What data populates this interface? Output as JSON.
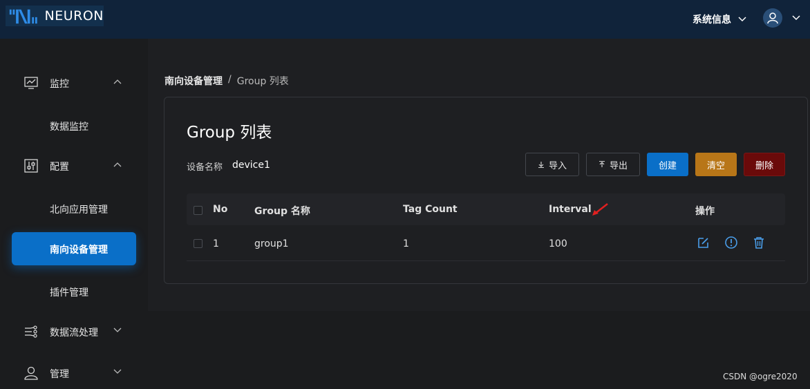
{
  "app": {
    "name": "NEURON"
  },
  "header": {
    "system_info_label": "系统信息"
  },
  "sidebar": {
    "groups": [
      {
        "label": "监控",
        "icon": "chart-monitor-icon",
        "items": [
          {
            "label": "数据监控"
          }
        ]
      },
      {
        "label": "配置",
        "icon": "config-sliders-icon",
        "items": [
          {
            "label": "北向应用管理"
          },
          {
            "label": "南向设备管理",
            "active": true
          },
          {
            "label": "插件管理"
          }
        ]
      },
      {
        "label": "数据流处理",
        "icon": "data-flow-icon",
        "items": []
      },
      {
        "label": "管理",
        "icon": "user-admin-icon",
        "items": []
      }
    ]
  },
  "breadcrumb": {
    "parent": "南向设备管理",
    "separator": "/",
    "current": "Group 列表"
  },
  "page": {
    "title": "Group 列表",
    "device_label": "设备名称",
    "device_name": "device1"
  },
  "toolbar": {
    "import_label": "导入",
    "export_label": "导出",
    "create_label": "创建",
    "clear_label": "清空",
    "delete_label": "删除"
  },
  "table": {
    "columns": [
      "No",
      "Group 名称",
      "Tag Count",
      "Interval",
      "操作"
    ],
    "rows": [
      {
        "no": "1",
        "name": "group1",
        "tag_count": "1",
        "interval": "100"
      }
    ]
  },
  "colors": {
    "primary": "#0a6fc8",
    "warning": "#b87618",
    "danger": "#6a0a0a",
    "header_bg": "#10233a"
  },
  "watermark": "CSDN @ogre2020"
}
